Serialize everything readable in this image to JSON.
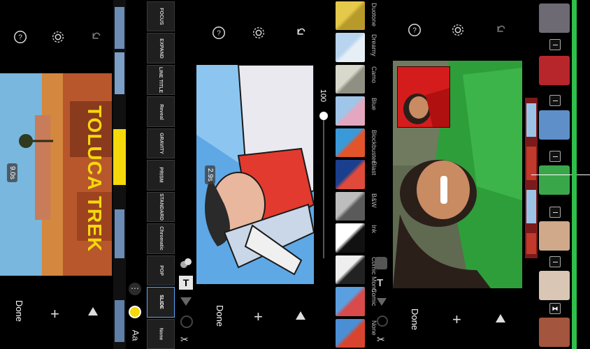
{
  "panel1": {
    "duration_badge": "9.0s",
    "title_text": "TOLUCA TREK",
    "done_label": "Done",
    "aa_label": "Aa",
    "styles": [
      "FOCUS",
      "EXPAND",
      "LINE TITLE",
      "Reveal",
      "GRAVITY",
      "PRISM",
      "STANDARD",
      "Chromatic",
      "POP",
      "SLIDE",
      "None"
    ]
  },
  "panel2": {
    "duration_badge": "2.9s",
    "slider_value": "100",
    "done_label": "Done",
    "filters": [
      "Duotone",
      "Dreamy",
      "Camo",
      "Blue",
      "Blockbuster",
      "Blast",
      "B&W",
      "Ink",
      "Comic Mono",
      "Comic",
      "None"
    ]
  },
  "panel3": {
    "done_label": "Done"
  },
  "colors": {
    "accent_yellow": "#f5d90a",
    "timeline_green": "#2fbf4a",
    "selection_blue": "#3a8ee6"
  }
}
